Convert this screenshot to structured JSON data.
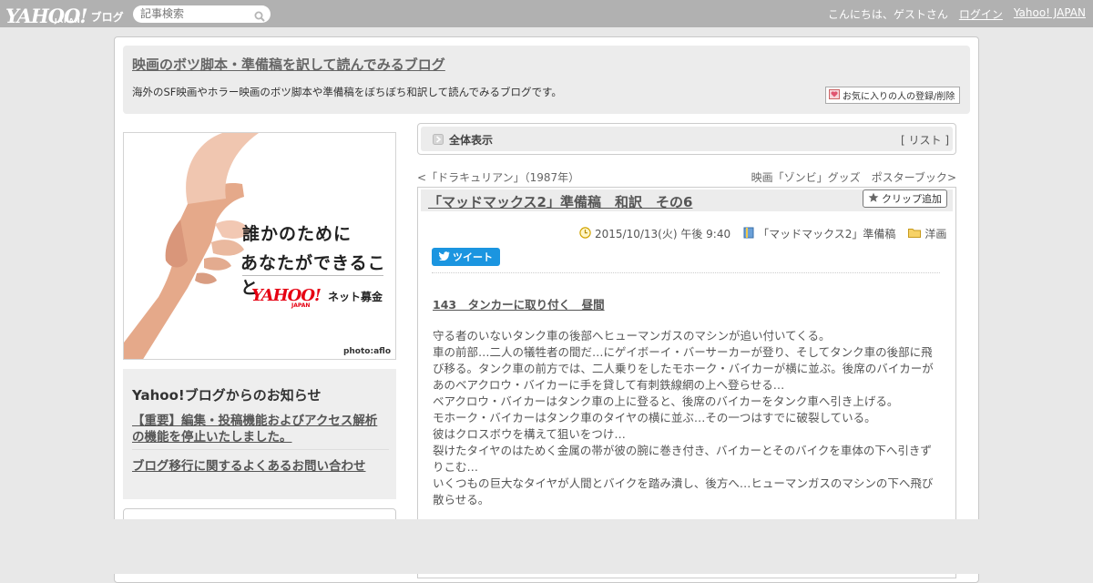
{
  "topbar": {
    "logo": "YAHOO!",
    "logo_sub": "JAPAN",
    "logo_blog": "ブログ",
    "search_placeholder": "記事検索",
    "greeting": "こんにちは、ゲストさん",
    "login": "ログイン",
    "yahoo_japan": "Yahoo! JAPAN"
  },
  "header": {
    "title": "映画のボツ脚本・準備稿を訳して読んでみるブログ",
    "description": "海外のSF映画やホラー映画のボツ脚本や準備稿をぼちぼち和訳して読んでみるブログです。",
    "favorite_button": "お気に入りの人の登録/削除"
  },
  "ad": {
    "line1": "誰かのために",
    "line2": "あなたができること",
    "logo": "YAHOO!",
    "logo_sub": "JAPAN",
    "service": "ネット募金",
    "credit": "photo:aflo"
  },
  "notice": {
    "heading": "Yahoo!ブログからのお知らせ",
    "items": [
      "【重要】編集・投稿機能およびアクセス解析の機能を停止いたしました。",
      "ブログ移行に関するよくあるお問い合わせ"
    ]
  },
  "viewbar": {
    "label": "全体表示",
    "list_open": "[ ",
    "list_link": "リスト",
    "list_close": " ]"
  },
  "nav": {
    "prev_mark": "<",
    "prev": "「ドラキュリアン」（1987年）",
    "next": "映画「ゾンビ」グッズ　ポスターブック",
    "next_mark": ">"
  },
  "article": {
    "title": "「マッドマックス2」準備稿　和訳　その6",
    "clip_button": "クリップ追加",
    "date": "2015/10/13(火) 午後 9:40",
    "category": "「マッドマックス2」準備稿",
    "folder": "洋画",
    "tweet": "ツイート",
    "section_heading": "143　タンカーに取り付く　昼間",
    "paragraphs": [
      "守る者のいないタンク車の後部へヒューマンガスのマシンが追い付いてくる。",
      "車の前部…二人の犠牲者の間だ…にゲイボーイ・バーサーカーが登り、そしてタンク車の後部に飛び移る。タンク車の前方では、二人乗りをしたモホーク・バイカーが横に並ぶ。後席のバイカーがあのベアクロウ・バイカーに手を貸して有刺鉄線網の上へ登らせる…",
      "ベアクロウ・バイカーはタンク車の上に登ると、後席のバイカーをタンク車へ引き上げる。",
      "モホーク・バイカーはタンク車のタイヤの横に並ぶ…その一つはすでに破裂している。",
      "彼はクロスボウを構えて狙いをつけ…",
      "裂けたタイヤのはためく金属の帯が彼の腕に巻き付き、バイカーとそのバイクを車体の下へ引きずりこむ…",
      "いくつもの巨大なタイヤが人間とバイクを踏み潰し、後方へ…ヒューマンガスのマシンの下へ飛び散らせる。"
    ]
  },
  "colors": {
    "topbar": "#b1b1b1",
    "page_bg": "#e8e8e8",
    "panel": "#ececec",
    "tweet": "#1b95e0",
    "ad_logo": "#e60012"
  }
}
